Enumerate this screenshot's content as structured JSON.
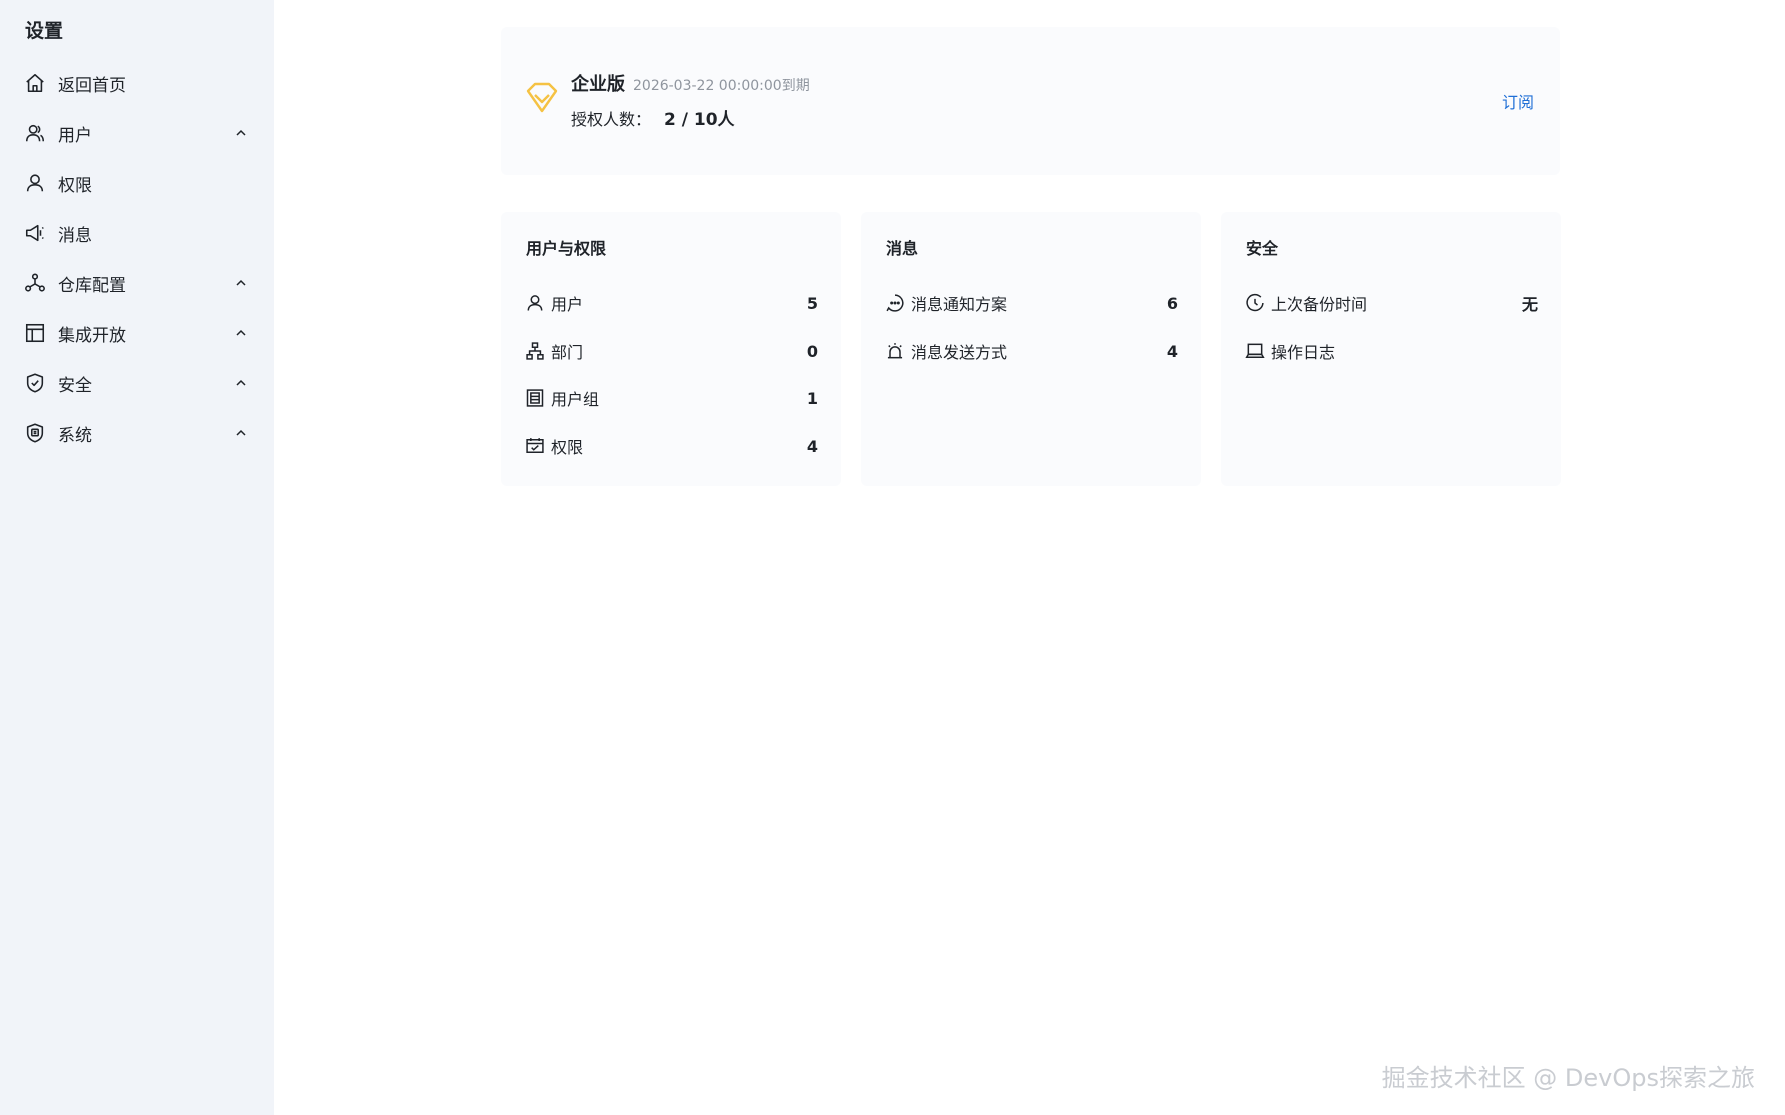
{
  "sidebar": {
    "title": "设置",
    "items": [
      {
        "label": "返回首页",
        "icon": "home-icon",
        "expandable": false
      },
      {
        "label": "用户",
        "icon": "users-icon",
        "expandable": true
      },
      {
        "label": "权限",
        "icon": "user-icon",
        "expandable": false
      },
      {
        "label": "消息",
        "icon": "megaphone-icon",
        "expandable": false
      },
      {
        "label": "仓库配置",
        "icon": "hub-icon",
        "expandable": true
      },
      {
        "label": "集成开放",
        "icon": "layout-icon",
        "expandable": true
      },
      {
        "label": "安全",
        "icon": "shield-check-icon",
        "expandable": true
      },
      {
        "label": "系统",
        "icon": "shield-gear-icon",
        "expandable": true
      }
    ]
  },
  "license": {
    "edition": "企业版",
    "expiry": "2026-03-22 00:00:00到期",
    "seats_label": "授权人数：",
    "seats_value": "2 / 10人",
    "subscribe_label": "订阅",
    "accent_color": "#f5c243"
  },
  "cards": [
    {
      "title": "用户与权限",
      "rows": [
        {
          "label": "用户",
          "value": "5",
          "icon": "user-icon"
        },
        {
          "label": "部门",
          "value": "0",
          "icon": "org-chart-icon"
        },
        {
          "label": "用户组",
          "value": "1",
          "icon": "building-icon"
        },
        {
          "label": "权限",
          "value": "4",
          "icon": "calendar-check-icon"
        }
      ]
    },
    {
      "title": "消息",
      "rows": [
        {
          "label": "消息通知方案",
          "value": "6",
          "icon": "chat-bubble-icon"
        },
        {
          "label": "消息发送方式",
          "value": "4",
          "icon": "alarm-icon"
        }
      ]
    },
    {
      "title": "安全",
      "rows": [
        {
          "label": "上次备份时间",
          "value": "无",
          "icon": "clock-icon"
        },
        {
          "label": "操作日志",
          "value": "",
          "icon": "laptop-icon"
        }
      ]
    }
  ],
  "watermark": "掘金技术社区 @ DevOps探索之旅",
  "colors": {
    "link": "#1f6fd6",
    "sidebar_bg": "#f1f4f9",
    "card_bg": "#fafbfd"
  }
}
